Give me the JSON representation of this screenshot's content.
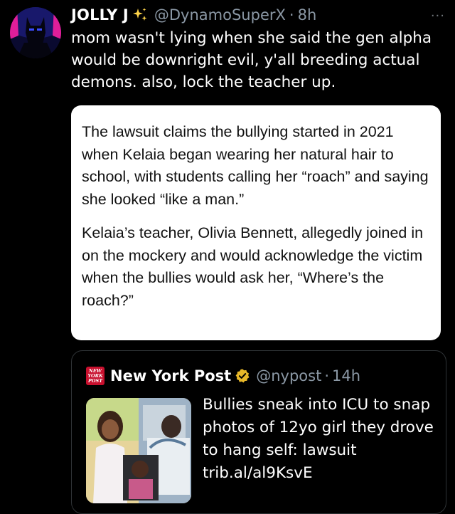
{
  "tweet": {
    "display_name": "JOLLY J",
    "name_emoji": "sparkles-icon",
    "handle": "@DynamoSuperX",
    "separator": "·",
    "time": "8h",
    "more_label": "···",
    "text": "mom wasn't lying when she said the gen alpha would be downright evil, y'all breeding actual demons. also, lock the teacher up.",
    "attached_image": {
      "paragraphs": [
        "The lawsuit claims the bullying started in 2021 when Kelaia began wearing her natural hair to school, with students calling her “roach” and saying she looked “like a man.”",
        "Kelaia’s teacher, Olivia Bennett, allegedly joined in on the mockery and would acknowledge the victim when the bullies would ask her, “Where’s the roach?”"
      ]
    }
  },
  "quoted_tweet": {
    "logo_text": [
      "NEW",
      "YORK",
      "POST"
    ],
    "display_name": "New York Post",
    "verified_badge": "gold-verified-icon",
    "handle": "@nypost",
    "separator": "·",
    "time": "14h",
    "text": "Bullies sneak into ICU to snap photos of 12yo girl they drove to hang self: lawsuit trib.al/al9KsvE"
  },
  "colors": {
    "background": "#000000",
    "text_primary": "#ffffff",
    "text_secondary": "#8b98a5",
    "border": "#2f3336",
    "nypost_red": "#c8102e",
    "verified_gold": "#e8b829"
  }
}
